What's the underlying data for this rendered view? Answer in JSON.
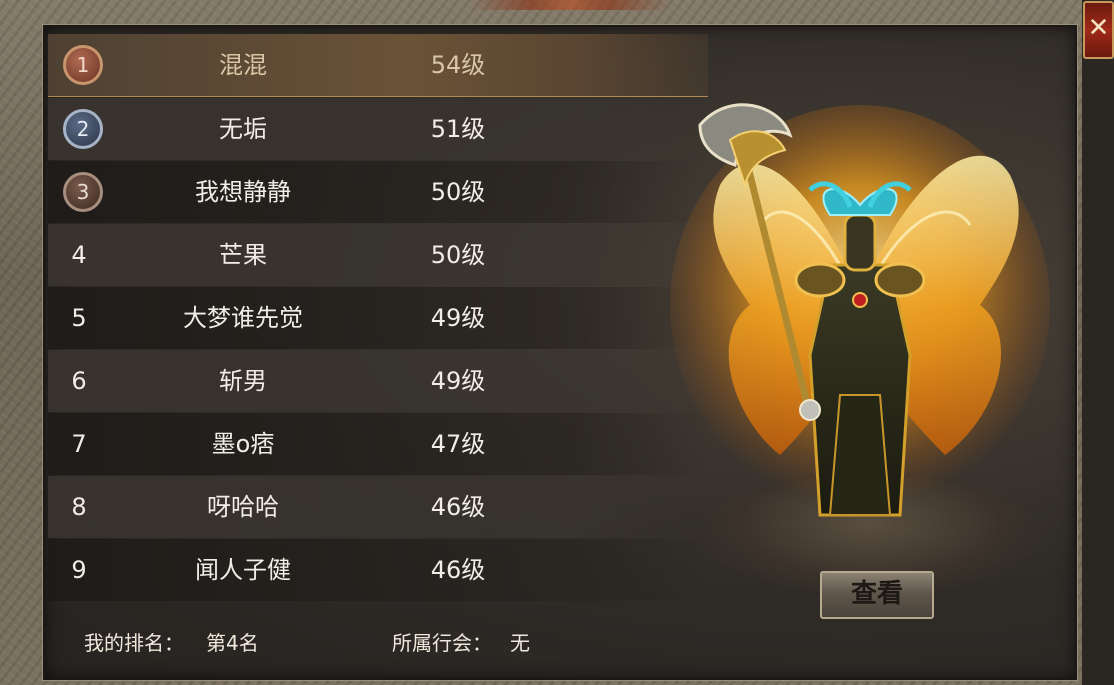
{
  "close_label": "✕",
  "rankings": [
    {
      "rank": "1",
      "name": "混混",
      "level": "54级",
      "medal": "gold",
      "selected": true
    },
    {
      "rank": "2",
      "name": "无垢",
      "level": "51级",
      "medal": "silver"
    },
    {
      "rank": "3",
      "name": "我想静静",
      "level": "50级",
      "medal": "bronze"
    },
    {
      "rank": "4",
      "name": "芒果",
      "level": "50级"
    },
    {
      "rank": "5",
      "name": "大梦谁先觉",
      "level": "49级"
    },
    {
      "rank": "6",
      "name": "斩男",
      "level": "49级"
    },
    {
      "rank": "7",
      "name": "墨o痞",
      "level": "47级"
    },
    {
      "rank": "8",
      "name": "呀哈哈",
      "level": "46级"
    },
    {
      "rank": "9",
      "name": "闻人子健",
      "level": "46级"
    }
  ],
  "view_button": "查看",
  "footer": {
    "my_rank_label": "我的排名：",
    "my_rank_value": "第4名",
    "guild_label": "所属行会：",
    "guild_value": "无"
  },
  "colors": {
    "accent_gold": "#d9a030",
    "frame_stone": "#7b715f",
    "close_red": "#a02a18"
  }
}
